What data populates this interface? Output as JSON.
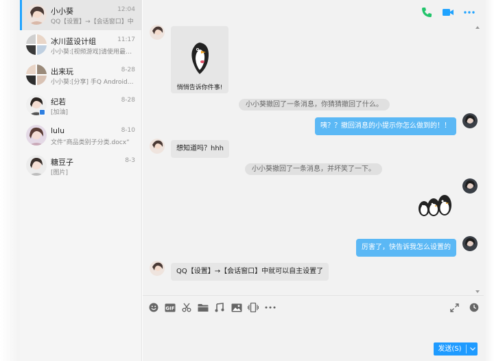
{
  "conversations": [
    {
      "name": "小小葵",
      "time": "12:04",
      "preview": "QQ【设置】→【会话窗口】中"
    },
    {
      "name": "冰川蓝设计组",
      "time": "11:17",
      "preview": "小小葵:[视频游戏]请使用最新版"
    },
    {
      "name": "出来玩",
      "time": "8-28",
      "preview": "小小葵:[分享] 手Q Android旗舰"
    },
    {
      "name": "纪若",
      "time": "8-28",
      "preview": "[加油]"
    },
    {
      "name": "lulu",
      "time": "8-10",
      "preview": "文件“商品类别子分类.docx”"
    },
    {
      "name": "糖豆子",
      "time": "8-3",
      "preview": "[图片]"
    }
  ],
  "messages": {
    "sticker_caption": "悄悄告诉你件事!",
    "notice1": "小小葵撤回了一条消息，你猜猜撤回了什么。",
    "out1": "咦？？撤回消息的小提示你怎么做到的！！",
    "in2": "想知道吗？hhh",
    "notice2": "小小葵撤回了一条消息，并坏笑了一下。",
    "out2": "厉害了，快告诉我怎么设置的",
    "in3": "QQ【设置】→【会话窗口】中就可以自主设置了"
  },
  "composer": {
    "send_label": "发送(S)",
    "toolbar_icons": [
      "emoji-icon",
      "gif-icon",
      "scissors-icon",
      "folder-icon",
      "music-icon",
      "image-icon",
      "shake-icon",
      "more-icon"
    ]
  },
  "header_icons": [
    "phone-call-icon",
    "video-call-icon",
    "more-options-icon"
  ],
  "colors": {
    "accent": "#1fa3ff",
    "bubble_out": "#5bb8f5",
    "bubble_in": "#e6e6e6",
    "phone_green": "#22c46b"
  }
}
